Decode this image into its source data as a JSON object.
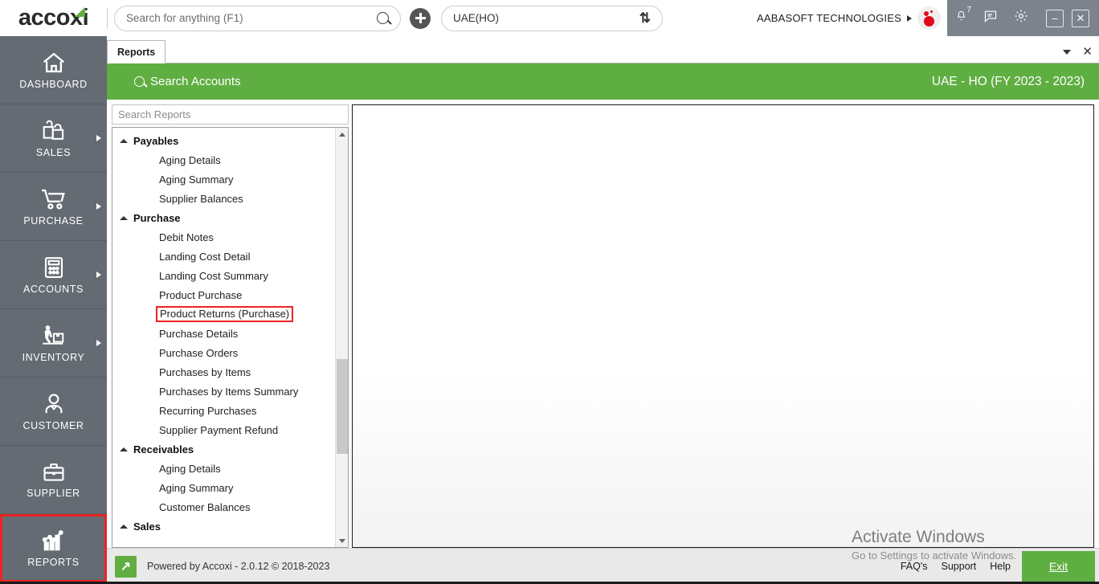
{
  "app": {
    "logo_text": "accoxi"
  },
  "topbar": {
    "search_placeholder": "Search for anything (F1)",
    "search_value": "",
    "branch_value": "UAE(HO)",
    "company_name": "AABASOFT TECHNOLOGIES",
    "notification_count": "7",
    "minimize_label": "–",
    "close_label": "✕"
  },
  "sidebar": {
    "items": [
      {
        "label": "DASHBOARD",
        "icon": "home-icon",
        "has_arrow": false,
        "active": false
      },
      {
        "label": "SALES",
        "icon": "shopping-bag-icon",
        "has_arrow": true,
        "active": false
      },
      {
        "label": "PURCHASE",
        "icon": "shopping-cart-icon",
        "has_arrow": true,
        "active": false
      },
      {
        "label": "ACCOUNTS",
        "icon": "calculator-icon",
        "has_arrow": true,
        "active": false
      },
      {
        "label": "INVENTORY",
        "icon": "warehouse-worker-icon",
        "has_arrow": true,
        "active": false
      },
      {
        "label": "CUSTOMER",
        "icon": "person-icon",
        "has_arrow": false,
        "active": false
      },
      {
        "label": "SUPPLIER",
        "icon": "briefcase-icon",
        "has_arrow": false,
        "active": false
      },
      {
        "label": "REPORTS",
        "icon": "bar-chart-icon",
        "has_arrow": false,
        "active": true
      }
    ]
  },
  "tabs": {
    "items": [
      {
        "label": "Reports",
        "active": true
      }
    ]
  },
  "green_header": {
    "title": "Search Accounts",
    "context": "UAE - HO (FY 2023 - 2023)"
  },
  "reports_panel": {
    "search_placeholder": "Search Reports",
    "search_value": "",
    "groups": [
      {
        "label": "Payables",
        "expanded": true,
        "items": [
          {
            "label": "Aging Details",
            "highlighted": false
          },
          {
            "label": "Aging Summary",
            "highlighted": false
          },
          {
            "label": "Supplier Balances",
            "highlighted": false
          }
        ]
      },
      {
        "label": "Purchase",
        "expanded": true,
        "items": [
          {
            "label": "Debit Notes",
            "highlighted": false
          },
          {
            "label": "Landing Cost Detail",
            "highlighted": false
          },
          {
            "label": "Landing Cost Summary",
            "highlighted": false
          },
          {
            "label": "Product Purchase",
            "highlighted": false
          },
          {
            "label": "Product Returns (Purchase)",
            "highlighted": true
          },
          {
            "label": "Purchase Details",
            "highlighted": false
          },
          {
            "label": "Purchase Orders",
            "highlighted": false
          },
          {
            "label": "Purchases by Items",
            "highlighted": false
          },
          {
            "label": "Purchases by Items Summary",
            "highlighted": false
          },
          {
            "label": "Recurring Purchases",
            "highlighted": false
          },
          {
            "label": "Supplier Payment Refund",
            "highlighted": false
          }
        ]
      },
      {
        "label": "Receivables",
        "expanded": true,
        "items": [
          {
            "label": "Aging Details",
            "highlighted": false
          },
          {
            "label": "Aging Summary",
            "highlighted": false
          },
          {
            "label": "Customer Balances",
            "highlighted": false
          }
        ]
      },
      {
        "label": "Sales",
        "expanded": true,
        "items": []
      }
    ]
  },
  "footer": {
    "powered_by": "Powered by Accoxi - 2.0.12 © 2018-2023",
    "links": [
      "FAQ's",
      "Support",
      "Help"
    ],
    "exit_label": "Exit"
  },
  "watermark": {
    "line1": "Activate Windows",
    "line2": "Go to Settings to activate Windows."
  }
}
